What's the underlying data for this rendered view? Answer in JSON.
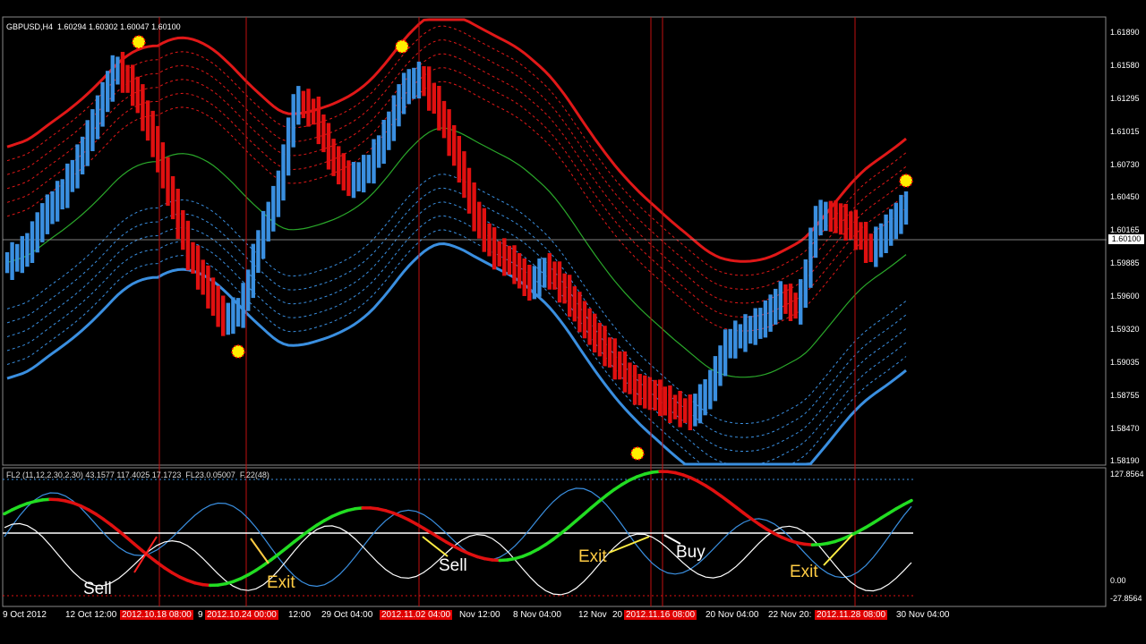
{
  "chart_data": {
    "type": "line",
    "symbol_header": "GBPUSD,H4  1.60294 1.60302 1.60047 1.60100",
    "indicator_header": "FL2 (11,12,2.30,2.30) 43.1577 117.4025 17.1723  FL23.0.05007  F.22(48)",
    "current_price": "1.60100",
    "price_ticks": [
      "1.61890",
      "1.61580",
      "1.61295",
      "1.61015",
      "1.60730",
      "1.60450",
      "1.60165",
      "1.59885",
      "1.59600",
      "1.59320",
      "1.59035",
      "1.58755",
      "1.58470",
      "1.58190"
    ],
    "indicator_ticks": [
      "127.8564",
      "0.00",
      "-27.8564"
    ],
    "time_labels": [
      {
        "text": "9 Oct 2012",
        "hl": false
      },
      {
        "text": "12 Oct 12:00",
        "hl": false
      },
      {
        "text": "2012.10.18 08:00",
        "hl": true
      },
      {
        "text": "9",
        "hl": false
      },
      {
        "text": "2012.10.24 00:00",
        "hl": true
      },
      {
        "text": "12:00",
        "hl": false
      },
      {
        "text": "29 Oct 04:00",
        "hl": false
      },
      {
        "text": "2012.11.02 04:00",
        "hl": true
      },
      {
        "text": "Nov 12:00",
        "hl": false
      },
      {
        "text": "8 Nov 04:00",
        "hl": false
      },
      {
        "text": "12 Nov",
        "hl": false
      },
      {
        "text": "20",
        "hl": false
      },
      {
        "text": "2012.11.16 08:00",
        "hl": true
      },
      {
        "text": "20 Nov 04:00",
        "hl": false
      },
      {
        "text": "22 Nov 20:",
        "hl": false
      },
      {
        "text": "2012.11.28 08:00",
        "hl": true
      },
      {
        "text": "30 Nov 04:00",
        "hl": false
      }
    ],
    "annotations": [
      {
        "text": "Sell",
        "color": "#ffffff"
      },
      {
        "text": "Exit",
        "color": "#ffcc44"
      },
      {
        "text": "Sell",
        "color": "#ffffff"
      },
      {
        "text": "Exit",
        "color": "#ffcc44"
      },
      {
        "text": "Buy",
        "color": "#ffffff"
      },
      {
        "text": "Exit",
        "color": "#ffcc44"
      }
    ],
    "colors": {
      "bull": "#3a8fe0",
      "bear": "#e01010",
      "ma": "#2aa82a",
      "upper_band": "#e01818",
      "lower_band": "#3a8fe0",
      "signal_up": "#22dd22",
      "signal_down": "#e01010",
      "grid": "#ffffff"
    },
    "price_path": [
      1.599,
      1.6,
      1.603,
      1.605,
      1.608,
      1.612,
      1.616,
      1.614,
      1.61,
      1.605,
      1.6,
      1.597,
      1.594,
      1.595,
      1.601,
      1.605,
      1.613,
      1.612,
      1.608,
      1.606,
      1.607,
      1.61,
      1.614,
      1.615,
      1.612,
      1.608,
      1.603,
      1.6,
      1.599,
      1.597,
      1.5985,
      1.5965,
      1.594,
      1.592,
      1.59,
      1.588,
      1.5875,
      1.5865,
      1.586,
      1.588,
      1.592,
      1.593,
      1.594,
      1.596,
      1.595,
      1.603,
      1.603,
      1.602,
      1.6,
      1.602,
      1.604
    ]
  }
}
